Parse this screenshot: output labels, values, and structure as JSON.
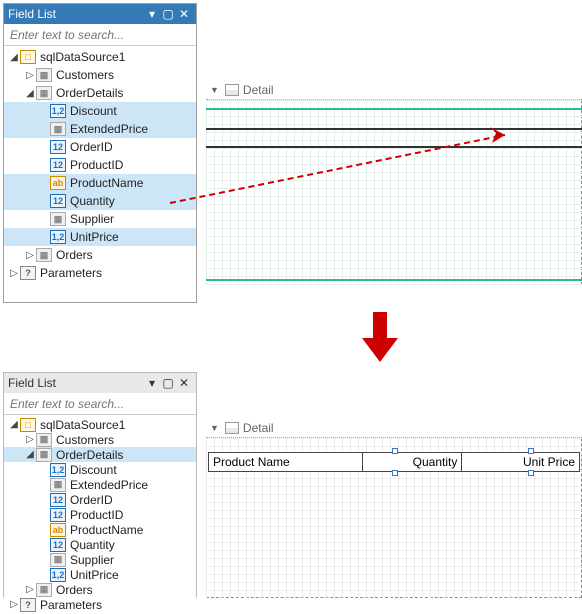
{
  "panel": {
    "title": "Field List"
  },
  "search": {
    "placeholder": "Enter text to search..."
  },
  "icons": {
    "ds": "□",
    "tbl": "▦",
    "dec": "1,2",
    "int": "12",
    "str": "ab",
    "par": "?"
  },
  "tree": {
    "root": "sqlDataSource1",
    "tables": {
      "customers": "Customers",
      "orderdetails": "OrderDetails",
      "orders": "Orders"
    },
    "fields": {
      "discount": "Discount",
      "extprice": "ExtendedPrice",
      "orderid": "OrderID",
      "productid": "ProductID",
      "productname": "ProductName",
      "quantity": "Quantity",
      "supplier": "Supplier",
      "unitprice": "UnitPrice"
    },
    "parameters": "Parameters"
  },
  "band": {
    "name": "Detail"
  },
  "result": {
    "cols": {
      "c1": "Product Name",
      "c2": "Quantity",
      "c3": "Unit Price"
    }
  }
}
